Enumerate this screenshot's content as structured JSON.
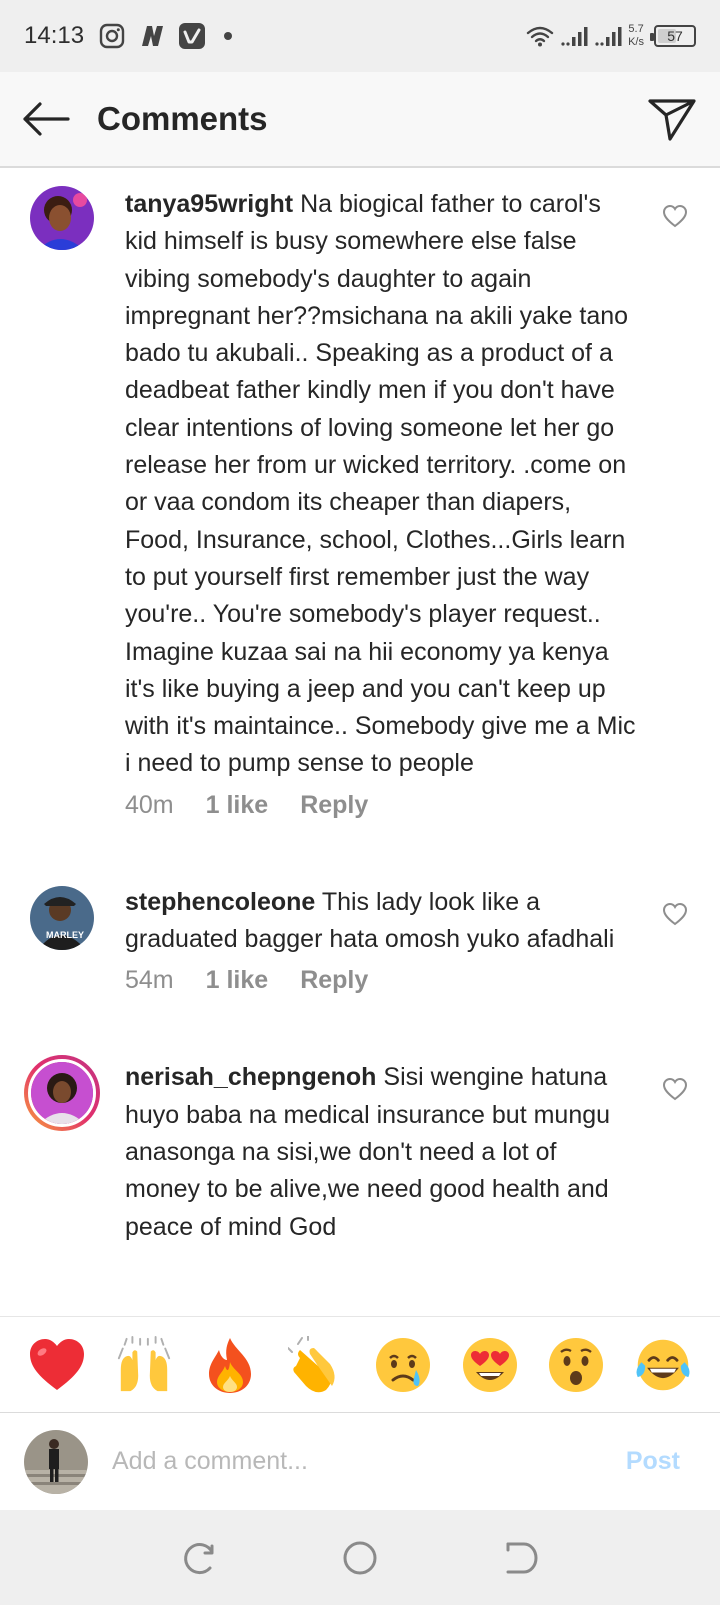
{
  "status_bar": {
    "time": "14:13",
    "net_speed_value": "5.7",
    "net_speed_unit": "K/s",
    "battery": "57",
    "battery_level": 0.57
  },
  "header": {
    "title": "Comments"
  },
  "comments": [
    {
      "username": "tanya95wright",
      "text": "Na biogical father to carol's kid  himself is busy somewhere else false vibing somebody's daughter to again impregnant her??msichana na akili yake tano bado tu akubali.. Speaking as a product of a deadbeat father kindly men if you don't have clear intentions of loving someone let her go release her from ur wicked territory. .come on or vaa condom its cheaper than diapers, Food, Insurance, school, Clothes...Girls learn to put yourself first remember just the way you're.. You're somebody's player request.. Imagine kuzaa sai na hii economy ya kenya it's like buying a jeep and you can't keep up with it's maintaince.. Somebody give me a Mic i need to pump sense to people",
      "time": "40m",
      "likes": "1 like",
      "reply": "Reply"
    },
    {
      "username": "stephencoleone",
      "text": "This lady look like a graduated bagger hata omosh yuko afadhali",
      "time": "54m",
      "likes": "1 like",
      "reply": "Reply"
    },
    {
      "username": "nerisah_chepngenoh",
      "text": "Sisi wengine hatuna huyo baba na medical insurance but mungu anasonga na sisi,we don't need a lot of money to be alive,we need good health and peace of mind God"
    }
  ],
  "reactions": [
    "heart",
    "raising-hands",
    "fire",
    "clapping-hands",
    "crying-face",
    "heart-eyes",
    "surprised-face",
    "tears-of-joy"
  ],
  "comment_bar": {
    "placeholder": "Add a comment...",
    "post_label": "Post"
  },
  "colors": {
    "accent_post": "#b3dbff",
    "muted_text": "#8e8e8e",
    "heart_red": "#ed2d36"
  }
}
